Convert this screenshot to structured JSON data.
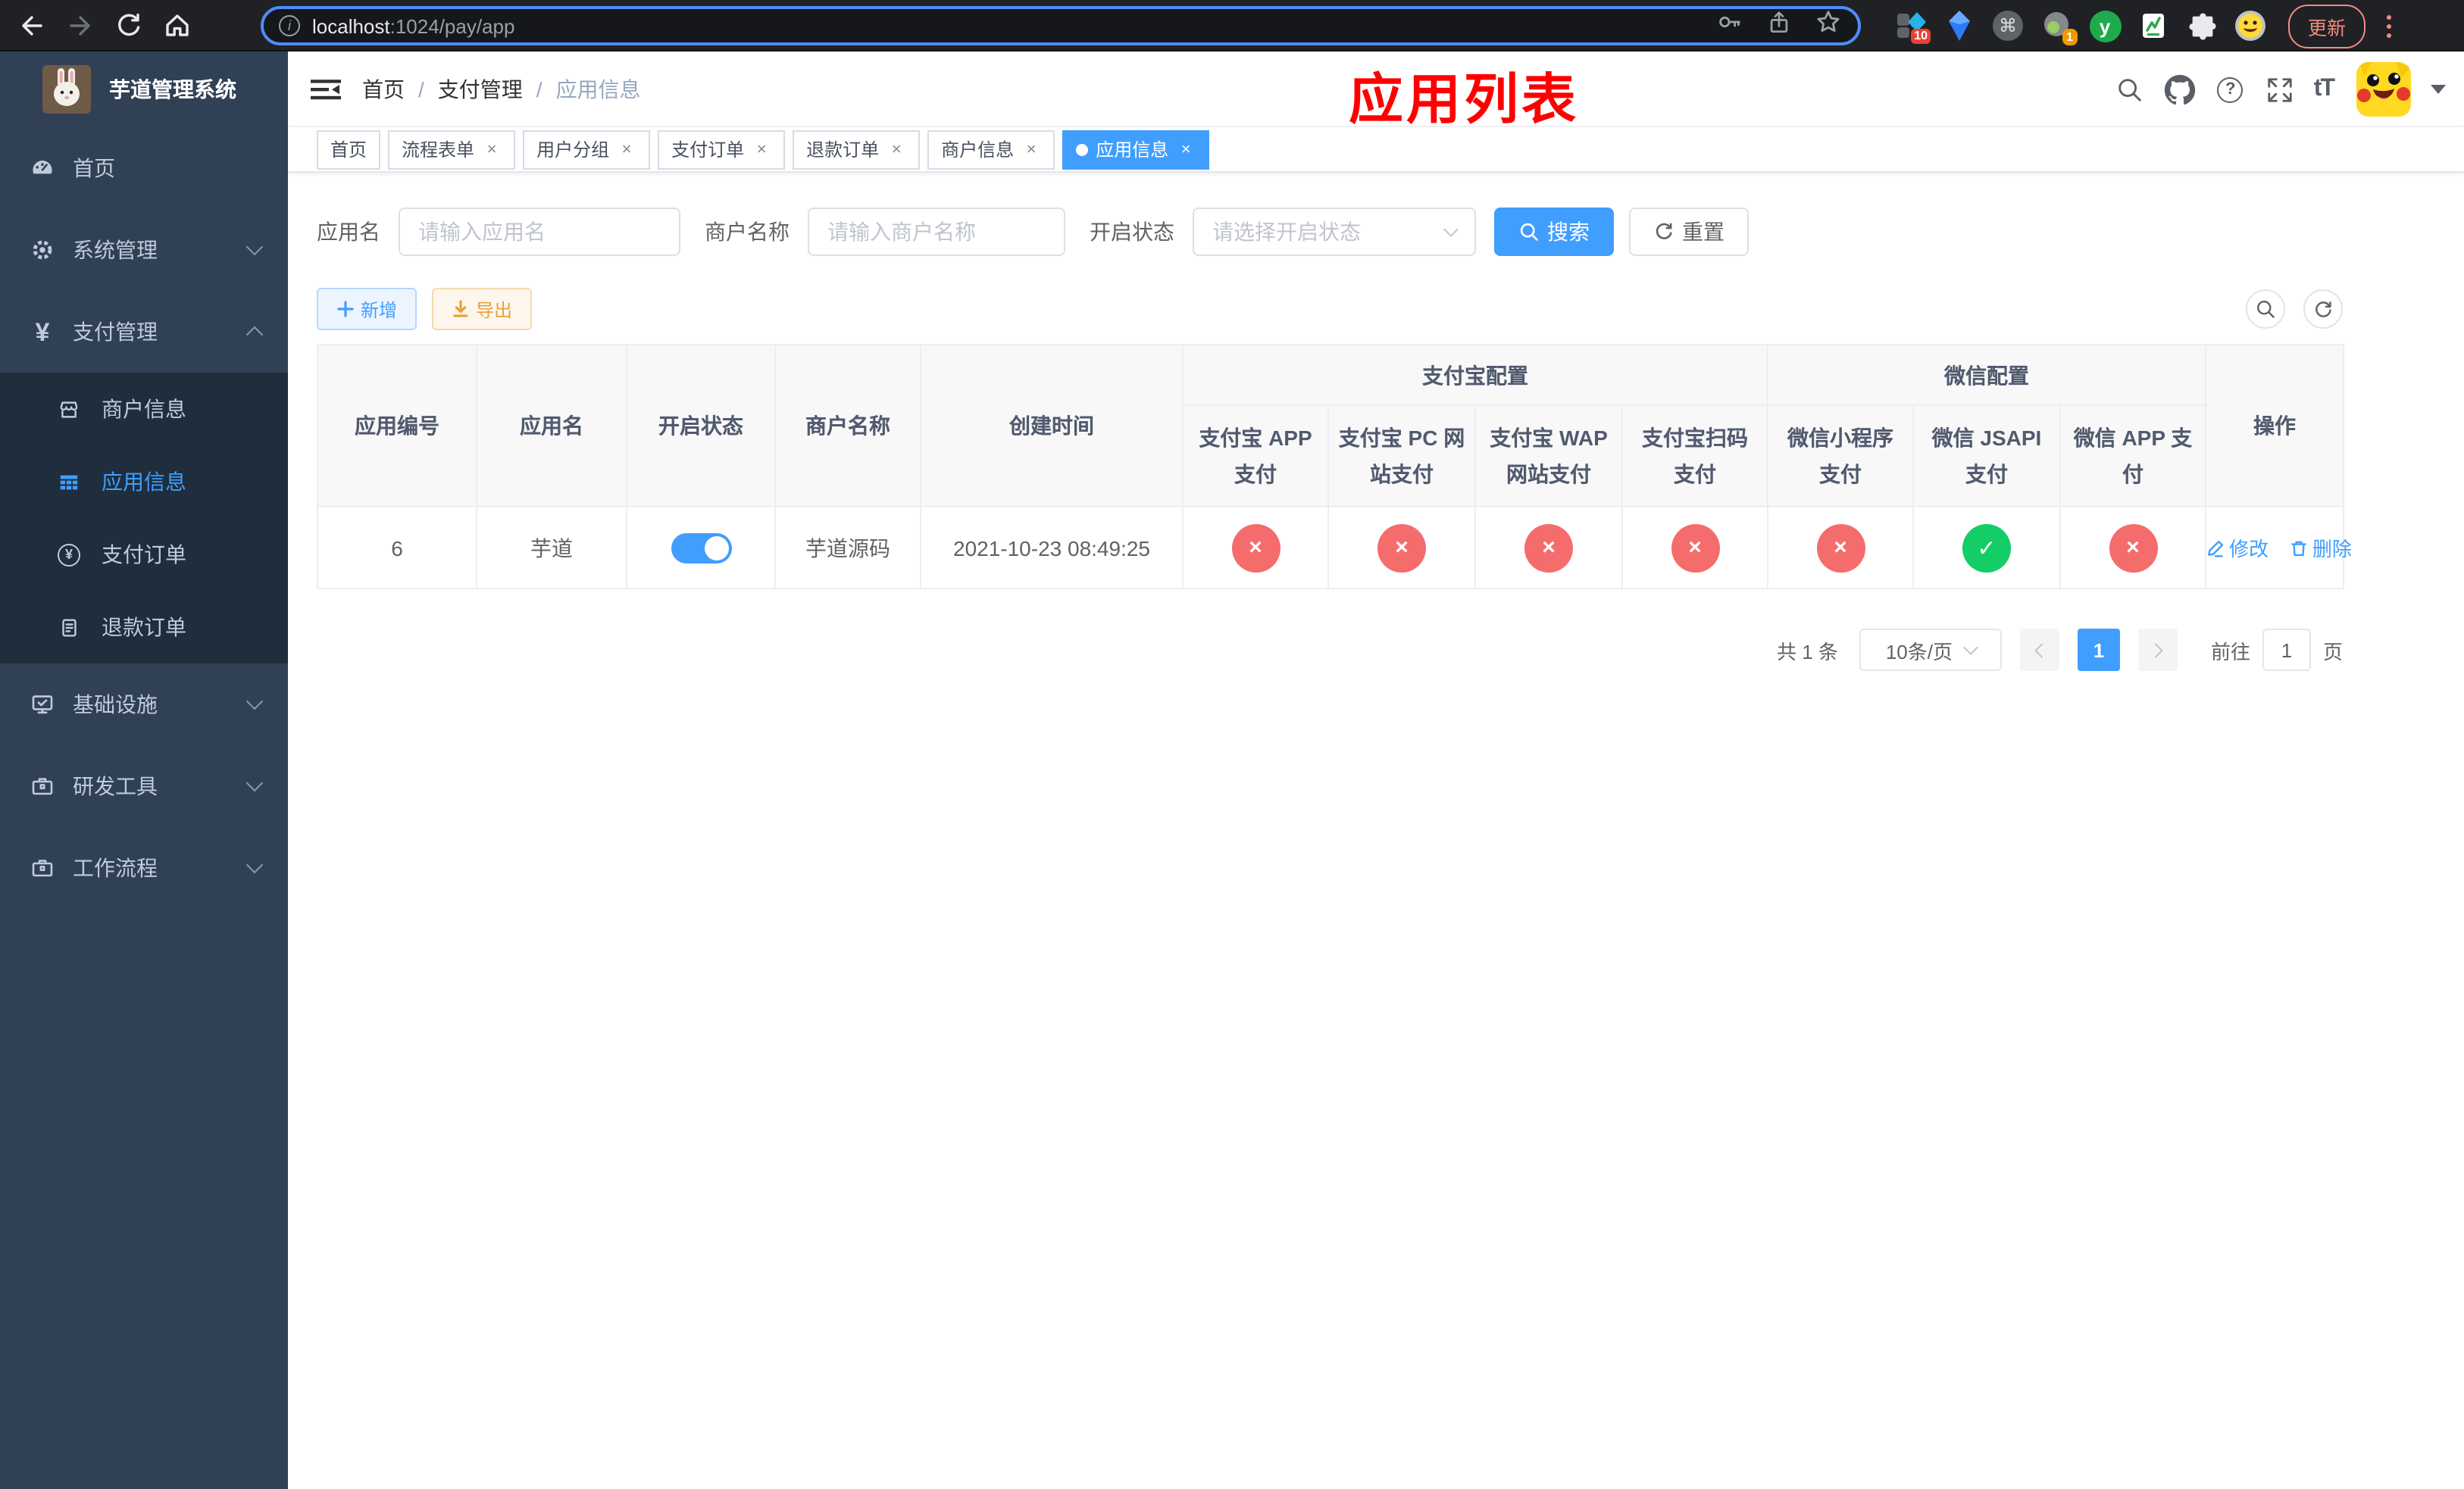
{
  "browser": {
    "url_host": "localhost",
    "url_rest": ":1024/pay/app",
    "update_label": "更新",
    "badges": {
      "extension": "10",
      "profile": "1"
    },
    "glyphs": {
      "info": "i",
      "command": "⌘",
      "y": "y"
    }
  },
  "sidebar": {
    "title": "芋道管理系统",
    "yen_glyph": "¥",
    "items": [
      {
        "label": "首页"
      },
      {
        "label": "系统管理"
      },
      {
        "label": "支付管理"
      },
      {
        "label": "商户信息"
      },
      {
        "label": "应用信息"
      },
      {
        "label": "支付订单"
      },
      {
        "label": "退款订单"
      },
      {
        "label": "基础设施"
      },
      {
        "label": "研发工具"
      },
      {
        "label": "工作流程"
      }
    ]
  },
  "header": {
    "breadcrumb": [
      "首页",
      "支付管理",
      "应用信息"
    ],
    "separator": "/",
    "annotation": "应用列表",
    "glyphs": {
      "help": "?",
      "text_size": "tT"
    }
  },
  "tabs": {
    "close_glyph": "×",
    "items": [
      {
        "label": "首页"
      },
      {
        "label": "流程表单"
      },
      {
        "label": "用户分组"
      },
      {
        "label": "支付订单"
      },
      {
        "label": "退款订单"
      },
      {
        "label": "商户信息"
      },
      {
        "label": "应用信息"
      }
    ]
  },
  "filters": {
    "app_name_label": "应用名",
    "app_name_placeholder": "请输入应用名",
    "merchant_label": "商户名称",
    "merchant_placeholder": "请输入商户名称",
    "status_label": "开启状态",
    "status_placeholder": "请选择开启状态",
    "search_button": "搜索",
    "reset_button": "重置"
  },
  "toolbar": {
    "add_button": "新增",
    "export_button": "导出"
  },
  "table": {
    "columns": [
      "应用编号",
      "应用名",
      "开启状态",
      "商户名称",
      "创建时间"
    ],
    "groups": [
      {
        "label": "支付宝配置"
      },
      {
        "label": "微信配置"
      }
    ],
    "sub_columns": [
      "支付宝 APP 支付",
      "支付宝 PC 网站支付",
      "支付宝 WAP 网站支付",
      "支付宝扫码支付",
      "微信小程序支付",
      "微信 JSAPI 支付",
      "微信 APP 支付"
    ],
    "actions_label": "操作",
    "row": {
      "id": "6",
      "name": "芋道",
      "switch_state": "on",
      "merchant": "芋道源码",
      "created_at": "2021-10-23 08:49:25",
      "channels": [
        {
          "state": "disabled",
          "glyph": "×"
        },
        {
          "state": "disabled",
          "glyph": "×"
        },
        {
          "state": "disabled",
          "glyph": "×"
        },
        {
          "state": "disabled",
          "glyph": "×"
        },
        {
          "state": "disabled",
          "glyph": "×"
        },
        {
          "state": "enabled",
          "glyph": "✓"
        },
        {
          "state": "disabled",
          "glyph": "×"
        }
      ],
      "edit_label": "修改",
      "delete_label": "删除"
    }
  },
  "pagination": {
    "total_label": "共 1 条",
    "page_size_label": "10条/页",
    "current_page": "1",
    "goto_label": "前往",
    "goto_value": "1",
    "page_unit_label": "页"
  },
  "colors": {
    "accent": "#409eff",
    "success": "#13ce66",
    "danger": "#f56c6c",
    "warning": "#e6a23c",
    "sidebar_bg": "#304156",
    "sidebar_submenu_bg": "#1f2d3d",
    "annotation": "#fe0000"
  }
}
